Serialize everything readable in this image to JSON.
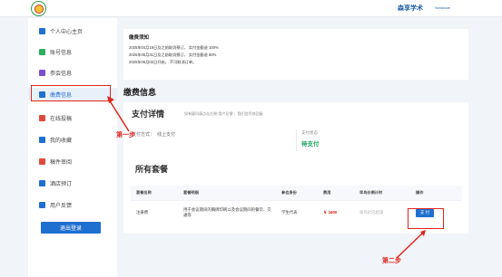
{
  "header": {
    "brand": "森享学术",
    "brand_sub": "Senshare"
  },
  "sidebar": {
    "items": [
      {
        "label": "个人中心主页",
        "icon": "home-icon",
        "color": "#1f6fd0"
      },
      {
        "label": "账号信息",
        "icon": "user-icon",
        "color": "#2eaf5f"
      },
      {
        "label": "参会信息",
        "icon": "users-icon",
        "color": "#7a4fd0"
      },
      {
        "label": "缴费信息",
        "icon": "payment-icon",
        "color": "#1f6fd0",
        "active": true
      },
      {
        "label": "在线投稿",
        "icon": "upload-icon",
        "color": "#e04a3b"
      },
      {
        "label": "我的收藏",
        "icon": "bookmark-icon",
        "color": "#1f6fd0"
      },
      {
        "label": "稿件审阅",
        "icon": "review-icon",
        "color": "#e04a3b"
      },
      {
        "label": "酒店预订",
        "icon": "hotel-icon",
        "color": "#1f6fd0"
      },
      {
        "label": "用户反馈",
        "icon": "feedback-icon",
        "color": "#1f6fd0"
      }
    ],
    "logout_label": "退出登录"
  },
  "notice": {
    "title": "缴费须知",
    "lines": [
      "2025年04月19日及之前取消预订， 实付金额退 100%",
      "2025年05月31日及之前取消预订， 实付金额退 80%",
      "2025年06月02日开始， 不可取消订单。"
    ]
  },
  "page_title": "缴费信息",
  "detail": {
    "title": "支付详情",
    "tip": "如有疑问请点击左侧“用户反馈”，我们会尽快回复",
    "method_label": "支付方式：",
    "method_value": "线上支付",
    "status_label": "支付状态",
    "status_value": "待支付"
  },
  "steps": {
    "step1": "第一步",
    "step2": "第二步"
  },
  "packages": {
    "title": "所有套餐",
    "columns": [
      "套餐名称",
      "套餐明细",
      "参会身份",
      "费用",
      "早鸟价倒计时",
      "操作"
    ],
    "rows": [
      {
        "name": "注册费",
        "desc": "用于会议期间的胸牌印刷以及会议期间的餐饮、交通等",
        "identity": "学生代表",
        "fee": "￥ 1600",
        "countdown": "早鸟价已结束",
        "action": "支 付"
      }
    ]
  },
  "colors": {
    "accent": "#1f6fd0",
    "highlight": "#e0241b",
    "status": "#1aa260"
  }
}
